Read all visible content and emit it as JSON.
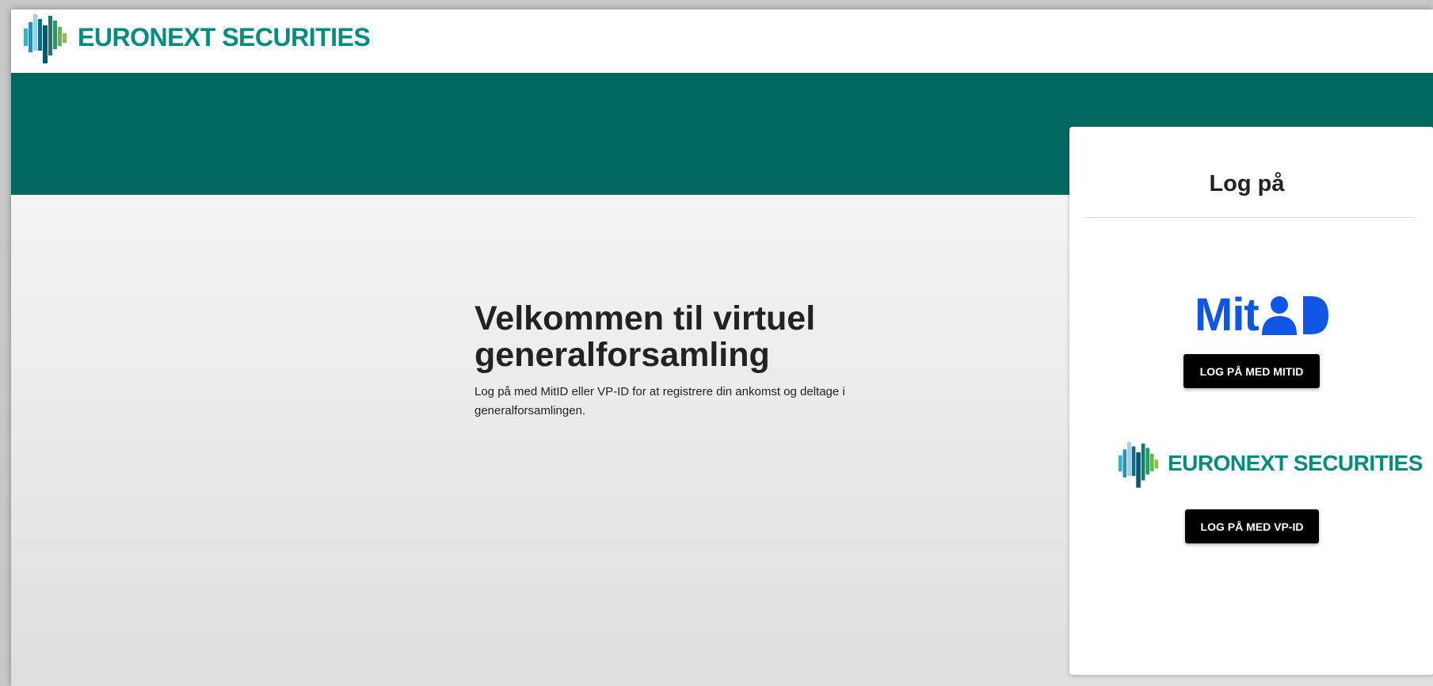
{
  "header": {
    "brand_name": "EURONEXT SECURITIES",
    "brand_color": "#008d7f",
    "hero_color": "#00685e"
  },
  "welcome": {
    "title": "Velkommen til virtuel generalforsamling",
    "description": "Log på med MitID eller VP-ID for at registrere din ankomst og deltage i generalforsamlingen."
  },
  "login_card": {
    "title": "Log på",
    "mitid": {
      "logo_text": "Mit",
      "logo_icon": "mitid-person-icon",
      "logo_color": "#0f55e6",
      "button_label": "LOG PÅ MED MITID"
    },
    "vpid": {
      "brand_name": "EURONEXT SECURITIES",
      "button_label": "LOG PÅ MED VP-ID"
    }
  }
}
